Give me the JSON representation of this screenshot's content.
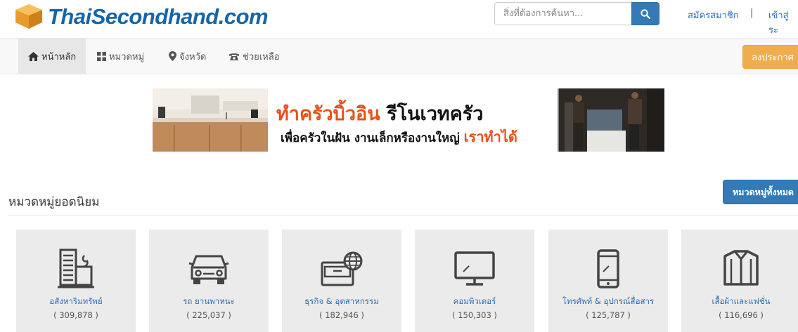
{
  "brand": {
    "logo_text": "ThaiSecondhand.com"
  },
  "search": {
    "placeholder": "สิ่งที่ต้องการค้นหา..."
  },
  "auth": {
    "register": "สมัครสมาชิก",
    "separator": "|",
    "login": "เข้าสู่ระ"
  },
  "nav": {
    "items": [
      {
        "label": "หน้าหลัก",
        "icon": "home-icon"
      },
      {
        "label": "หมวดหมู่",
        "icon": "grid-icon"
      },
      {
        "label": "จังหวัด",
        "icon": "map-marker-icon"
      },
      {
        "label": "ช่วยเหลือ",
        "icon": "phone-icon"
      }
    ],
    "post_button": "ลงประกาศ"
  },
  "banner": {
    "line1_orange": "ทำครัวบิ้วอิน",
    "line1_black": "รีโนเวทครัว",
    "line2_black": "เพื่อครัวในฝัน งานเล็กหรืองานใหญ่",
    "line2_orange": "เราทำได้"
  },
  "section": {
    "title": "หมวดหมู่ยอดนิยม",
    "all_button": "หมวดหมู่ทั้งหมด"
  },
  "categories": [
    {
      "name": "อสังหาริมทรัพย์",
      "count": "( 309,878 )",
      "icon": "building-icon"
    },
    {
      "name": "รถ ยานพาหนะ",
      "count": "( 225,037 )",
      "icon": "car-icon"
    },
    {
      "name": "ธุรกิจ & อุตสาหกรรม",
      "count": "( 182,946 )",
      "icon": "business-icon"
    },
    {
      "name": "คอมพิวเตอร์",
      "count": "( 150,303 )",
      "icon": "monitor-icon"
    },
    {
      "name": "โทรศัพท์ & อุปกรณ์สื่อสาร",
      "count": "( 125,787 )",
      "icon": "smartphone-icon"
    },
    {
      "name": "เสื้อผ้าและแฟชั่น",
      "count": "( 116,696 )",
      "icon": "shirt-icon"
    }
  ],
  "colors": {
    "link": "#2a6db5",
    "primary": "#337ab7",
    "warning": "#f0ad4e",
    "banner_orange": "#e8501a"
  }
}
